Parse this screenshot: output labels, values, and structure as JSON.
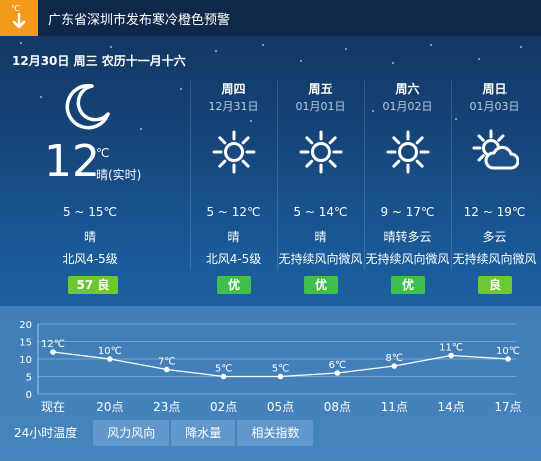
{
  "alert": {
    "unit": "℃",
    "text": "广东省深圳市发布寒冷橙色预警"
  },
  "date_line": "12月30日 周三 农历十一月十六",
  "today": {
    "temp": "12",
    "unit": "℃",
    "label": "晴(实时)",
    "range": "5 ~ 15℃",
    "condition": "晴",
    "wind": "北风4-5级",
    "aqi": "57 良"
  },
  "forecast": [
    {
      "day": "周四",
      "date": "12月31日",
      "icon": "sun-icon",
      "range": "5 ~ 12℃",
      "condition": "晴",
      "wind": "北风4-5级",
      "aq": "优",
      "aq_color": "#3fbf4f"
    },
    {
      "day": "周五",
      "date": "01月01日",
      "icon": "sun-icon",
      "range": "5 ~ 14℃",
      "condition": "晴",
      "wind": "无持续风向微风",
      "aq": "优",
      "aq_color": "#3fbf4f"
    },
    {
      "day": "周六",
      "date": "01月02日",
      "icon": "sun-icon",
      "range": "9 ~ 17℃",
      "condition": "晴转多云",
      "wind": "无持续风向微风",
      "aq": "优",
      "aq_color": "#3fbf4f"
    },
    {
      "day": "周日",
      "date": "01月03日",
      "icon": "partly-cloudy-icon",
      "range": "12 ~ 19℃",
      "condition": "多云",
      "wind": "无持续风向微风",
      "aq": "良",
      "aq_color": "#6ec734"
    }
  ],
  "chart_data": {
    "type": "line",
    "categories": [
      "现在",
      "20点",
      "23点",
      "02点",
      "05点",
      "08点",
      "11点",
      "14点",
      "17点"
    ],
    "values": [
      12,
      10,
      7,
      5,
      5,
      6,
      8,
      11,
      10
    ],
    "labels": [
      "12℃",
      "10℃",
      "7℃",
      "5℃",
      "5℃",
      "6℃",
      "8℃",
      "11℃",
      "10℃"
    ],
    "yticks": [
      "0",
      "5",
      "10",
      "15",
      "20"
    ],
    "ylim": [
      0,
      20
    ],
    "grid": true
  },
  "tabs": [
    "24小时温度",
    "风力风向",
    "降水量",
    "相关指数"
  ],
  "active_tab": 0
}
